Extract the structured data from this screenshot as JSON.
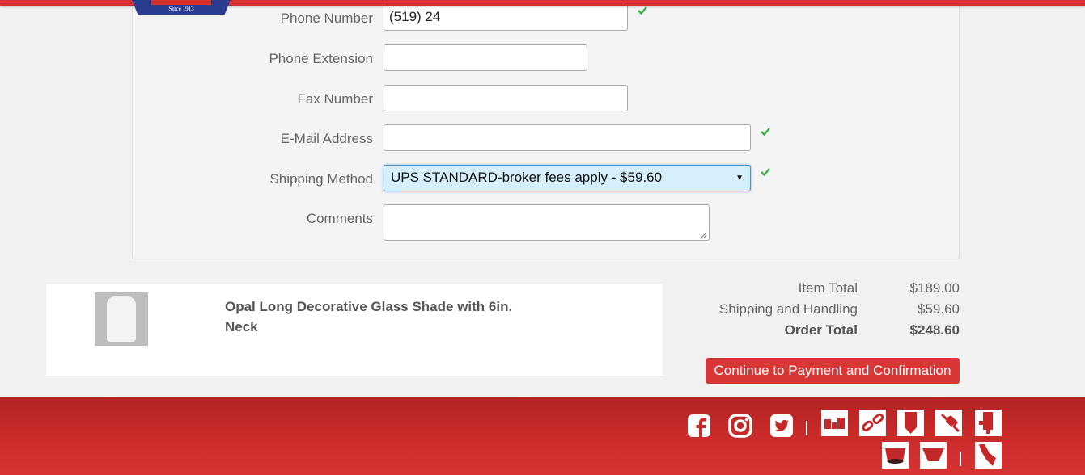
{
  "header": {
    "logo_tagline": "Since 1913",
    "brand_color": "#d63130"
  },
  "form": {
    "phone": {
      "label": "Phone Number",
      "value": "(519) 24",
      "valid": true
    },
    "phone_ext": {
      "label": "Phone Extension",
      "value": ""
    },
    "fax": {
      "label": "Fax Number",
      "value": ""
    },
    "email": {
      "label": "E-Mail Address",
      "value": "",
      "valid": true
    },
    "shipping": {
      "label": "Shipping Method",
      "selected": "UPS STANDARD-broker fees apply - $59.60",
      "valid": true
    },
    "comments": {
      "label": "Comments",
      "value": ""
    }
  },
  "cart": {
    "item": {
      "title": "Opal Long Decorative Glass Shade with 6in. Neck",
      "thumbnail_icon": "glass-shade-thumbnail"
    }
  },
  "totals": {
    "item_total_label": "Item Total",
    "item_total": "$189.00",
    "shipping_label": "Shipping and Handling",
    "shipping": "$59.60",
    "order_total_label": "Order Total",
    "order_total": "$248.60"
  },
  "actions": {
    "continue_label": "Continue to Payment and Confirmation"
  },
  "footer": {
    "social_icons": [
      "facebook-icon",
      "instagram-icon",
      "twitter-icon"
    ],
    "category_icons": [
      "hardware-icon",
      "chain-icon",
      "pendant-icon",
      "plug-icon",
      "wall-fixture-icon",
      "shade-icon",
      "cup-icon",
      "sconce-icon"
    ]
  }
}
